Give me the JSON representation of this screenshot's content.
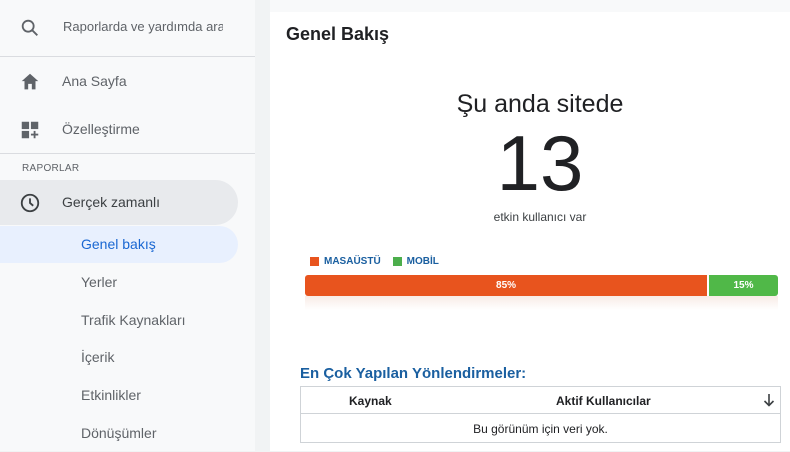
{
  "sidebar": {
    "search_placeholder": "Raporlarda ve yardımda ara",
    "home_label": "Ana Sayfa",
    "customize_label": "Özelleştirme",
    "section_title": "RAPORLAR",
    "realtime_label": "Gerçek zamanlı",
    "sub_items": [
      {
        "label": "Genel bakış",
        "active": true
      },
      {
        "label": "Yerler"
      },
      {
        "label": "Trafik Kaynakları"
      },
      {
        "label": "İçerik"
      },
      {
        "label": "Etkinlikler"
      },
      {
        "label": "Dönüşümler"
      }
    ]
  },
  "main": {
    "title": "Genel Bakış",
    "now_label": "Şu anda sitede",
    "now_count": "13",
    "now_sub": "etkin kullanıcı var",
    "legend": [
      {
        "label": "MASAÜSTÜ",
        "color": "#e8541e"
      },
      {
        "label": "MOBİL",
        "color": "#4cae4c"
      }
    ],
    "device_split": [
      {
        "label": "85%",
        "value": 85,
        "color": "#e8541e"
      },
      {
        "label": "15%",
        "value": 15,
        "color": "#50b848"
      }
    ],
    "table": {
      "title": "En Çok Yapılan Yönlendirmeler:",
      "col_source": "Kaynak",
      "col_active": "Aktif Kullanıcılar",
      "empty_text": "Bu görünüm için veri yok."
    }
  }
}
